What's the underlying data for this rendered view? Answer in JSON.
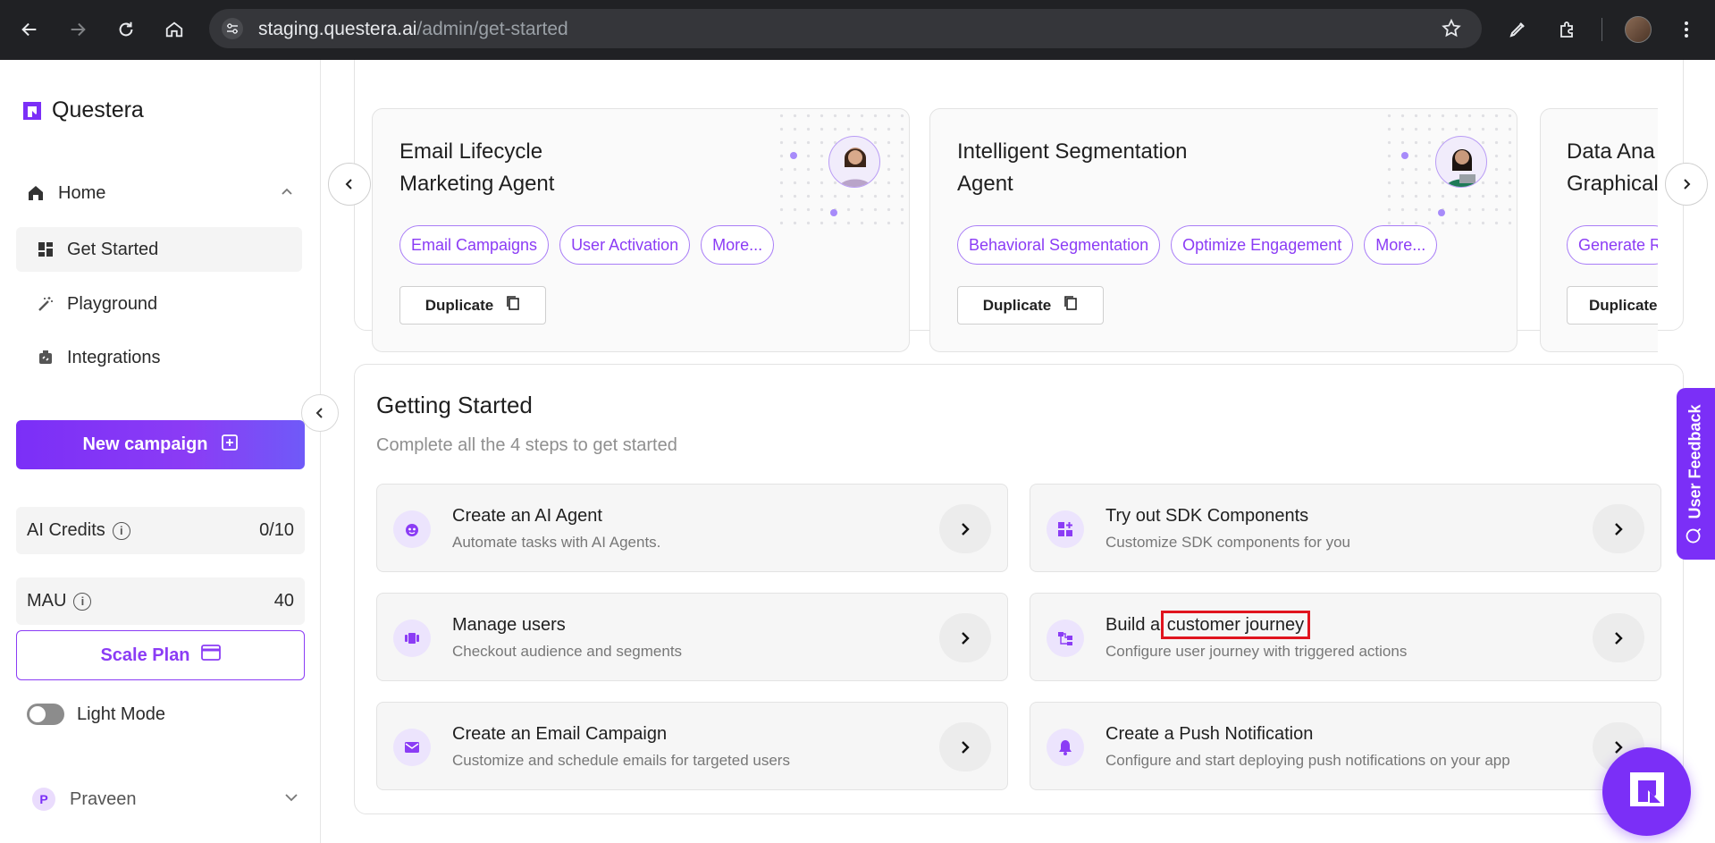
{
  "browser": {
    "url_host": "staging.questera.ai",
    "url_path": "/admin/get-started"
  },
  "sidebar": {
    "brand": "Questera",
    "home_label": "Home",
    "items": [
      {
        "label": "Get Started",
        "icon": "grid-icon"
      },
      {
        "label": "Playground",
        "icon": "magic-wand-icon"
      },
      {
        "label": "Integrations",
        "icon": "integration-icon"
      }
    ],
    "new_campaign_label": "New campaign",
    "ai_credits_label": "AI Credits",
    "ai_credits_value": "0/10",
    "mau_label": "MAU",
    "mau_value": "40",
    "info_glyph": "i",
    "scale_plan_label": "Scale Plan",
    "theme_label": "Light Mode",
    "user_initial": "P",
    "user_name": "Praveen"
  },
  "agents": {
    "cards": [
      {
        "title_line1": "Email Lifecycle",
        "title_line2": "Marketing Agent",
        "tags": [
          "Email Campaigns",
          "User Activation",
          "More..."
        ],
        "duplicate_label": "Duplicate"
      },
      {
        "title_line1": "Intelligent Segmentation",
        "title_line2": "Agent",
        "tags": [
          "Behavioral Segmentation",
          "Optimize Engagement",
          "More..."
        ],
        "duplicate_label": "Duplicate"
      },
      {
        "title_line1": "Data Ana",
        "title_line2": "Graphical",
        "tags": [
          "Generate R"
        ],
        "duplicate_label": "Duplicate"
      }
    ]
  },
  "getting_started": {
    "title": "Getting Started",
    "subtitle": "Complete all the 4 steps to get started",
    "steps": [
      {
        "title": "Create an AI Agent",
        "desc": "Automate tasks with AI Agents.",
        "icon": "bot-face-icon"
      },
      {
        "title": "Try out SDK Components",
        "desc": "Customize SDK components for you",
        "icon": "widgets-icon"
      },
      {
        "title": "Manage users",
        "desc": "Checkout audience and segments",
        "icon": "users-icon"
      },
      {
        "title_prefix": "Build a ",
        "title_highlight": "customer journey",
        "desc": "Configure user journey with triggered actions",
        "icon": "flow-icon"
      },
      {
        "title": "Create an Email Campaign",
        "desc": "Customize and schedule emails for targeted users",
        "icon": "mail-icon"
      },
      {
        "title": "Create a Push Notification",
        "desc": "Configure and start deploying push notifications on your app",
        "icon": "bell-icon"
      }
    ]
  },
  "feedback_label": "User Feedback",
  "colors": {
    "accent": "#7b2ff7",
    "highlight_box": "#e0141e"
  }
}
